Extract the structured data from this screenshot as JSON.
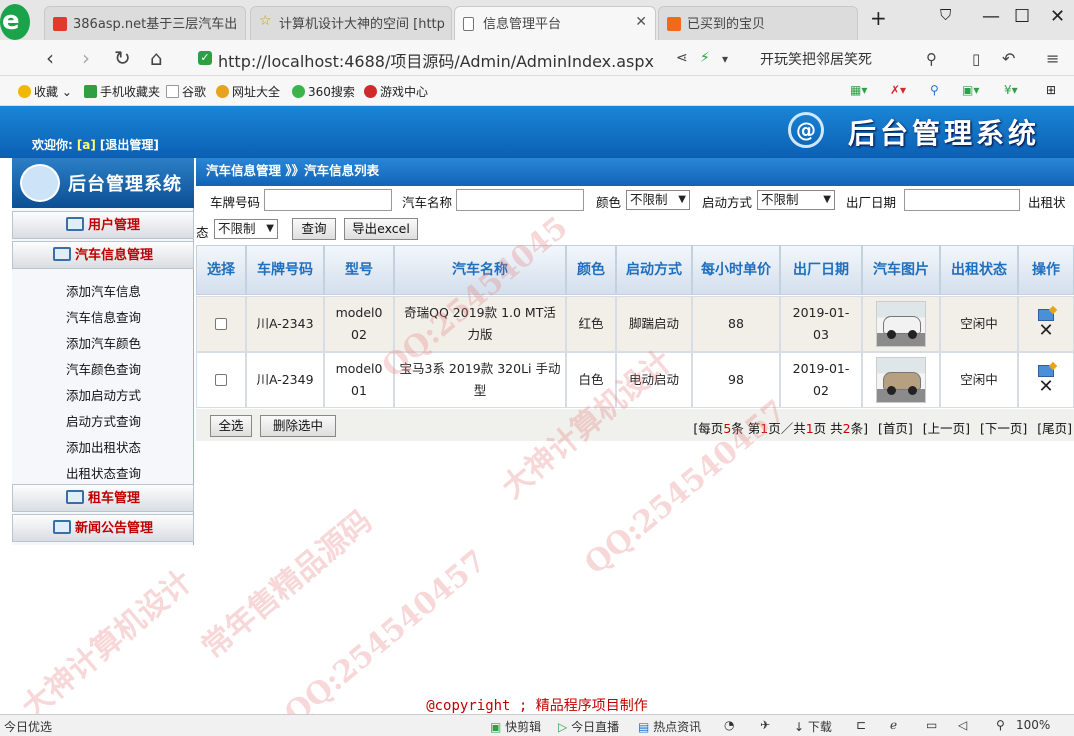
{
  "browser": {
    "tabs": [
      {
        "label": "386asp.net基于三层汽车出",
        "icon": "site-favicon-icon"
      },
      {
        "label": "计算机设计大神的空间 [http",
        "icon": "star-icon"
      },
      {
        "label": "信息管理平台",
        "icon": "page-icon"
      },
      {
        "label": "已买到的宝贝",
        "icon": "taobao-icon"
      }
    ],
    "active_tab": 2,
    "url": "http://localhost:4688/项目源码/Admin/AdminIndex.aspx",
    "search_text": "开玩笑把邻居笑死",
    "bookmarks": [
      "收藏",
      "手机收藏夹",
      "谷歌",
      "网址大全",
      "360搜索",
      "游戏中心"
    ]
  },
  "header": {
    "welcome_label": "欢迎你:",
    "username": "[a]",
    "logout_label": "[退出管理]",
    "system_title": "后台管理系统"
  },
  "sidebar": {
    "title": "后台管理系统",
    "groups": [
      {
        "label": "用户管理",
        "items": []
      },
      {
        "label": "汽车信息管理",
        "items": [
          "添加汽车信息",
          "汽车信息查询",
          "添加汽车颜色",
          "汽车颜色查询",
          "添加启动方式",
          "启动方式查询",
          "添加出租状态",
          "出租状态查询"
        ]
      },
      {
        "label": "租车管理",
        "items": []
      },
      {
        "label": "新闻公告管理",
        "items": []
      }
    ]
  },
  "breadcrumb": "汽车信息管理 》》汽车信息列表",
  "filters": {
    "plate_label": "车牌号码",
    "name_label": "汽车名称",
    "color_label": "颜色",
    "color_value": "不限制",
    "start_label": "启动方式",
    "start_value": "不限制",
    "date_label": "出厂日期",
    "rent_label": "出租状",
    "rent_label_tail": "态",
    "rent_value": "不限制",
    "query_button": "查询",
    "export_button": "导出excel"
  },
  "table": {
    "headers": [
      "选择",
      "车牌号码",
      "型号",
      "汽车名称",
      "颜色",
      "启动方式",
      "每小时单价",
      "出厂日期",
      "汽车图片",
      "出租状态",
      "操作"
    ],
    "rows": [
      {
        "plate": "川A-2343",
        "model": "model002",
        "name": "奇瑞QQ 2019款 1.0 MT活力版",
        "color": "红色",
        "start": "脚踹启动",
        "price": "88",
        "date": "2019-01-03",
        "status": "空闲中",
        "car_color": "#f2f2f2"
      },
      {
        "plate": "川A-2349",
        "model": "model001",
        "name": "宝马3系 2019款 320Li 手动型",
        "color": "白色",
        "start": "电动启动",
        "price": "98",
        "date": "2019-01-02",
        "status": "空闲中",
        "car_color": "#b79f82"
      }
    ]
  },
  "footer_buttons": {
    "select_all": "全选",
    "delete_selected": "删除选中"
  },
  "pager": {
    "p1": "[每页",
    "per_page": "5",
    "p2": "条 第",
    "page": "1",
    "p3": "页／共",
    "pages": "1",
    "p4": "页 共",
    "total": "2",
    "p5": "条]",
    "first": "[首页]",
    "prev": "[上一页]",
    "next": "[下一页]",
    "last": "[尾页]"
  },
  "copyright": {
    "left": "@copyright ;",
    "right": "精品程序项目制作"
  },
  "statusbar": {
    "left": "今日优选",
    "items": [
      "快剪辑",
      "今日直播",
      "热点资讯",
      "下载"
    ],
    "zoom": "100%"
  },
  "watermark": [
    "QQ:25454045",
    "常年售精品源码",
    "大神计算机设计",
    "QQ:254540457"
  ]
}
